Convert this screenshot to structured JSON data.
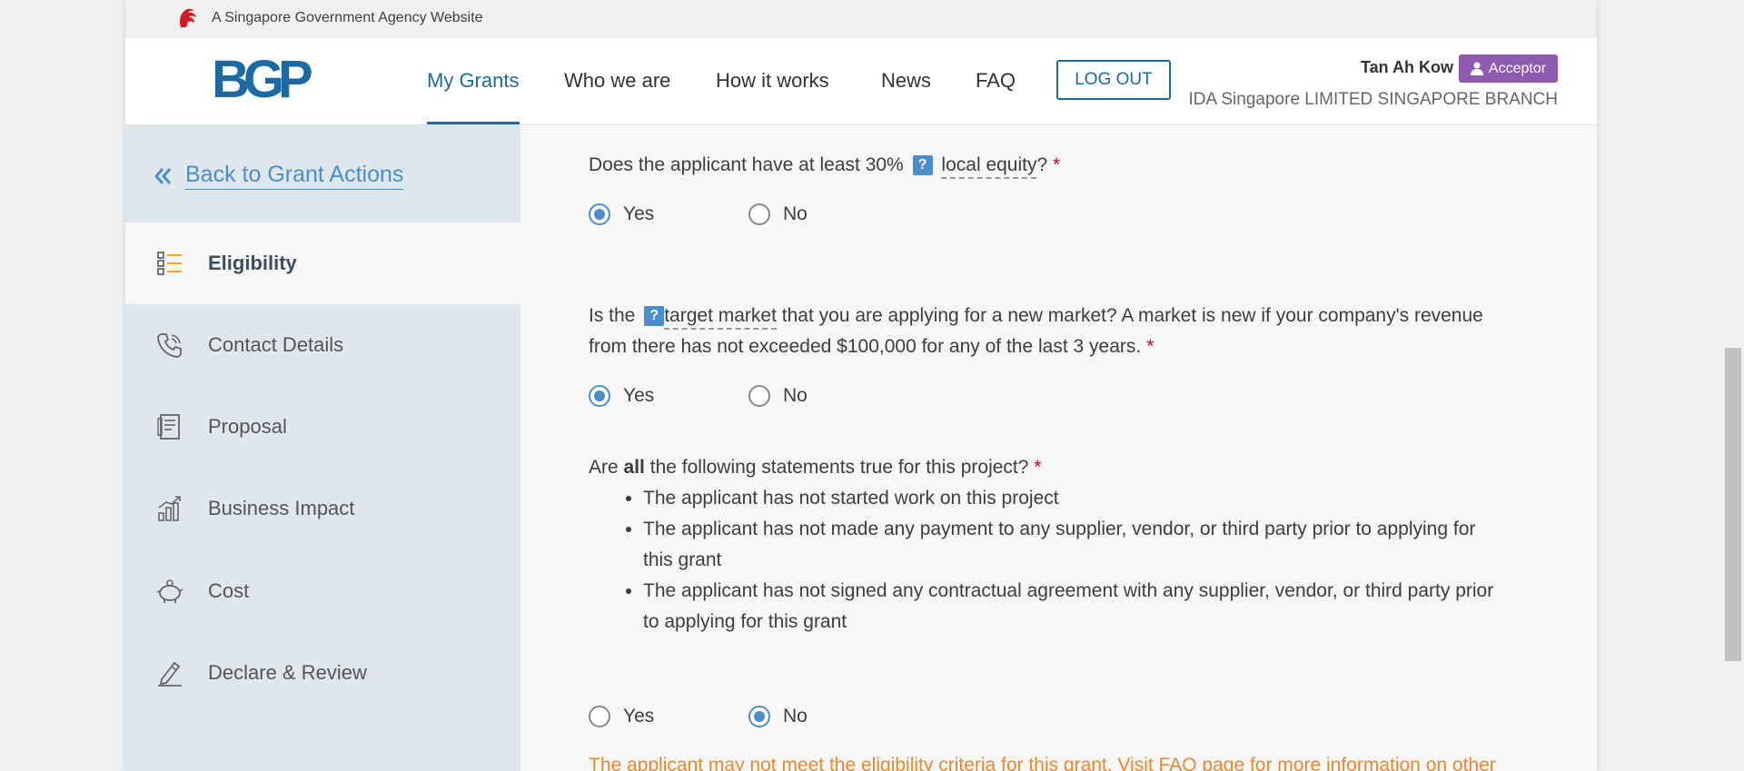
{
  "masthead": {
    "text": "A Singapore Government Agency Website"
  },
  "header": {
    "logo": "BGP",
    "nav": [
      {
        "label": "My Grants",
        "active": true
      },
      {
        "label": "Who we are",
        "active": false
      },
      {
        "label": "How it works",
        "active": false
      },
      {
        "label": "News",
        "active": false
      },
      {
        "label": "FAQ",
        "active": false
      }
    ],
    "logout_label": "LOG OUT",
    "user": {
      "name": "Tan Ah Kow",
      "role": "Acceptor",
      "org": "IDA Singapore LIMITED SINGAPORE BRANCH"
    }
  },
  "sidebar": {
    "back_label": "Back to Grant Actions",
    "items": [
      {
        "label": "Eligibility",
        "icon": "list-icon",
        "active": true
      },
      {
        "label": "Contact Details",
        "icon": "phone-icon",
        "active": false
      },
      {
        "label": "Proposal",
        "icon": "document-icon",
        "active": false
      },
      {
        "label": "Business Impact",
        "icon": "bar-chart-icon",
        "active": false
      },
      {
        "label": "Cost",
        "icon": "piggy-bank-icon",
        "active": false
      },
      {
        "label": "Declare & Review",
        "icon": "pen-icon",
        "active": false
      }
    ]
  },
  "questions": {
    "q1": {
      "prefix": "Does the applicant have at least 30%",
      "term": "local equity",
      "suffix": "?",
      "required": "*",
      "help": "?",
      "options": [
        "Yes",
        "No"
      ],
      "selected": "Yes"
    },
    "q2": {
      "prefix": "Is the",
      "term": "target market",
      "suffix": " that you are applying for a new market? A market is new if your company's revenue from there has not exceeded $100,000 for any of the last 3 years.",
      "required": "*",
      "help": "?",
      "options": [
        "Yes",
        "No"
      ],
      "selected": "Yes"
    },
    "q3": {
      "prefix": "Are",
      "bold": "all",
      "suffix": "the following statements true for this project?",
      "required": "*",
      "statements": [
        "The applicant has not started work on this project",
        "The applicant has not made any payment to any supplier, vendor, or third party prior to applying for this grant",
        "The applicant has not signed any contractual agreement with any supplier, vendor, or third party prior to applying for this grant"
      ],
      "options": [
        "Yes",
        "No"
      ],
      "selected": "No"
    }
  },
  "warning": "The applicant may not meet the eligibility criteria for this grant. Visit FAQ page for more information on other",
  "colors": {
    "brand": "#1b6aa5",
    "accent": "#4a8ed0",
    "role_badge": "#8e5bb0",
    "warning": "#e8892b",
    "required": "#d0021b"
  }
}
